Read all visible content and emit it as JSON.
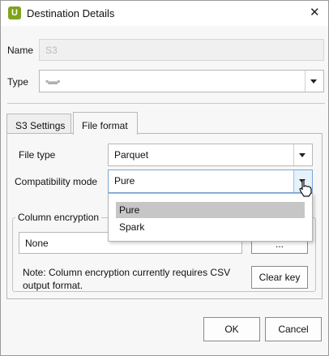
{
  "window": {
    "title": "Destination Details",
    "close_glyph": "✕",
    "app_icon": "U"
  },
  "form": {
    "name_label": "Name",
    "name_value": "S3",
    "type_label": "Type",
    "type_value": "▪▬▪"
  },
  "tabs": [
    {
      "label": "S3 Settings"
    },
    {
      "label": "File format"
    }
  ],
  "file_format": {
    "file_type_label": "File type",
    "file_type_value": "Parquet",
    "compat_label": "Compatibility mode",
    "compat_value": "Pure",
    "compat_options": [
      "Pure",
      "Spark"
    ]
  },
  "column_encryption": {
    "title": "Column encryption",
    "value": "None",
    "browse_label": "...",
    "note": "Note: Column encryption currently requires CSV output format.",
    "clear_key_label": "Clear key"
  },
  "footer": {
    "ok_label": "OK",
    "cancel_label": "Cancel"
  },
  "colors": {
    "accent": "#7fa31c",
    "selection": "#c6c6c6"
  }
}
